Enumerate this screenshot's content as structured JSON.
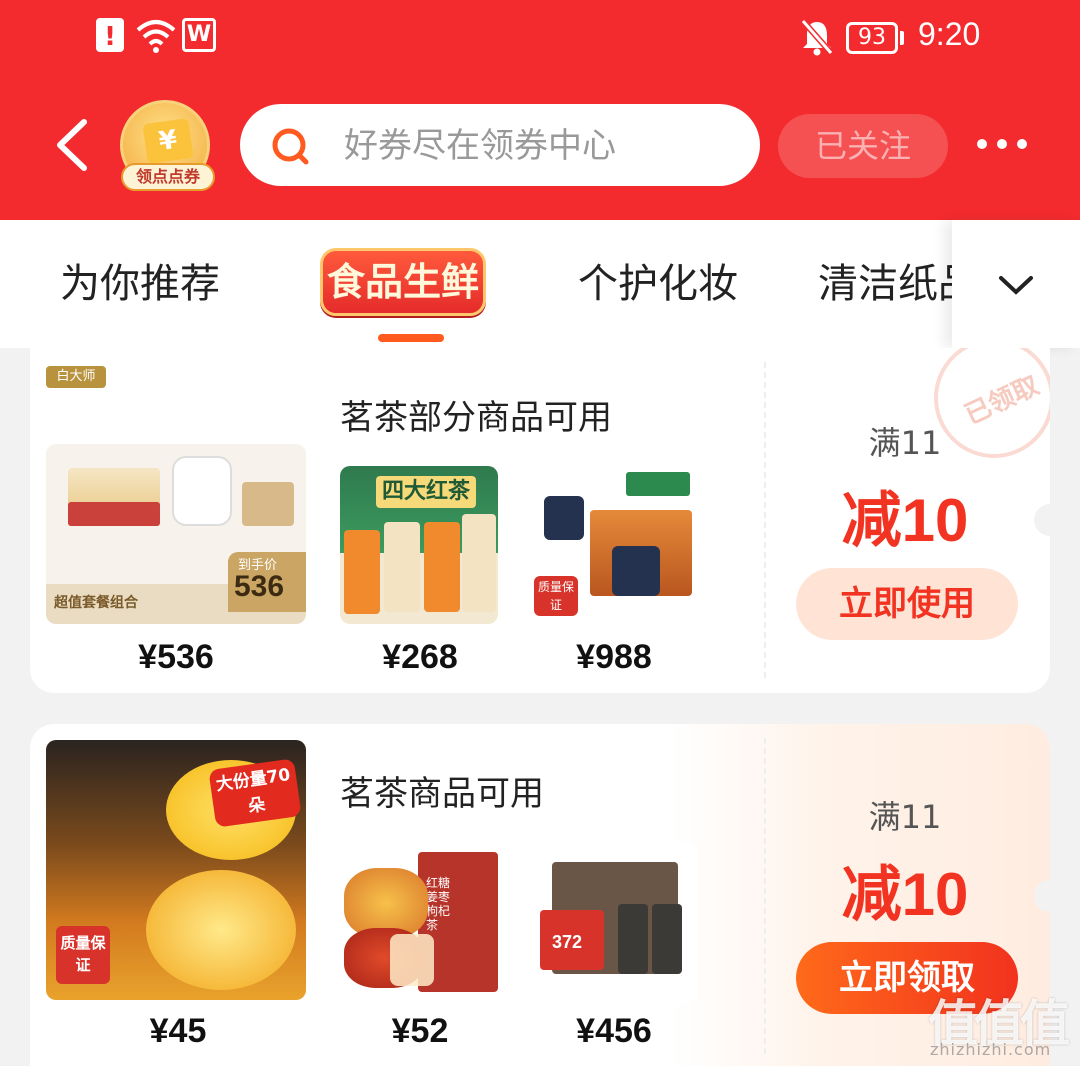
{
  "status_bar": {
    "battery": "93",
    "time": "9:20",
    "app_icon": "W"
  },
  "header": {
    "coupon_badge_label": "领点点券",
    "coupon_badge_glyph": "¥",
    "search_placeholder": "好券尽在领券中心",
    "follow_label": "已关注",
    "accent_color": "#f32b2e"
  },
  "tabs": [
    {
      "label": "为你推荐"
    },
    {
      "label": "食品生鲜",
      "active": true
    },
    {
      "label": "个护化妆"
    },
    {
      "label": "清洁纸品"
    }
  ],
  "coupons": [
    {
      "brand": "白大师",
      "title": "茗茶部分商品可用",
      "products": [
        {
          "price": "¥536",
          "img_text": "超值套餐组合",
          "img_price": "536",
          "img_price_label": "到手价"
        },
        {
          "price": "¥268",
          "img_text": "四大红茶"
        },
        {
          "price": "¥988",
          "img_text": "质量保证"
        }
      ],
      "condition": "满11",
      "amount": "减10",
      "button": "立即使用",
      "stamp": "已领取"
    },
    {
      "title": "茗茶商品可用",
      "products": [
        {
          "price": "¥45",
          "img_text": "大份量70朵",
          "img_badge": "质量保证"
        },
        {
          "price": "¥52",
          "img_text": "红糖姜枣枸杞茶"
        },
        {
          "price": "¥456",
          "img_text": "372"
        }
      ],
      "condition": "满11",
      "amount": "减10",
      "button": "立即领取"
    }
  ],
  "watermark": {
    "big": "值值值",
    "small": "zhizhizhi.com"
  }
}
